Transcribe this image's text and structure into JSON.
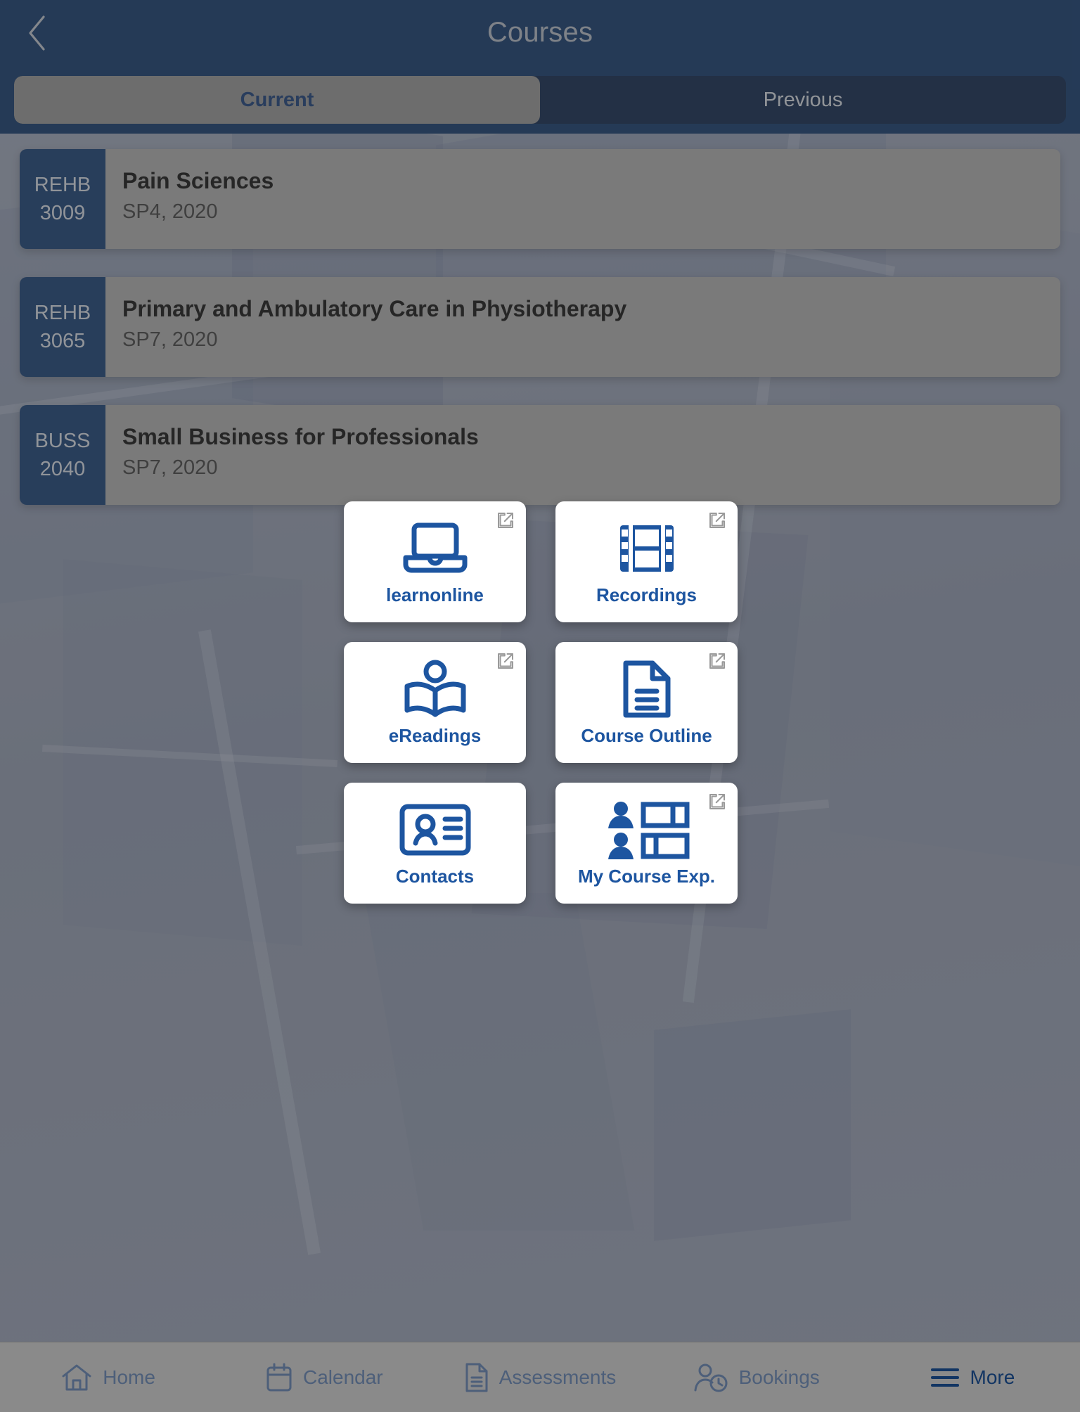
{
  "header": {
    "title": "Courses",
    "back_icon": "chevron-left-icon"
  },
  "tabs": {
    "current_label": "Current",
    "previous_label": "Previous",
    "selected": "Current"
  },
  "courses": [
    {
      "code_prefix": "REHB",
      "code_number": "3009",
      "title": "Pain Sciences",
      "term": "SP4, 2020"
    },
    {
      "code_prefix": "REHB",
      "code_number": "3065",
      "title": "Primary and Ambulatory Care in Physiotherapy",
      "term": "SP7, 2020"
    },
    {
      "code_prefix": "BUSS",
      "code_number": "2040",
      "title": "Small Business for Professionals",
      "term": "SP7, 2020"
    }
  ],
  "action_tiles": [
    {
      "label": "learnonline",
      "icon": "laptop-icon",
      "external": true
    },
    {
      "label": "Recordings",
      "icon": "film-strip-icon",
      "external": true
    },
    {
      "label": "eReadings",
      "icon": "person-reading-icon",
      "external": true
    },
    {
      "label": "Course Outline",
      "icon": "document-icon",
      "external": true
    },
    {
      "label": "Contacts",
      "icon": "contact-card-icon",
      "external": false
    },
    {
      "label": "My Course Exp.",
      "icon": "survey-people-icon",
      "external": true
    }
  ],
  "bottom_nav": [
    {
      "label": "Home",
      "icon": "home-icon",
      "active": false
    },
    {
      "label": "Calendar",
      "icon": "calendar-icon",
      "active": false
    },
    {
      "label": "Assessments",
      "icon": "document-icon",
      "active": false
    },
    {
      "label": "Bookings",
      "icon": "person-clock-icon",
      "active": false
    },
    {
      "label": "More",
      "icon": "hamburger-icon",
      "active": true
    }
  ],
  "colors": {
    "header_navy": "#0e3263",
    "badge_navy": "#143a6b",
    "tile_blue": "#1d55a0",
    "card_gray": "#a0a0a0",
    "nav_bg": "#8a8a8a"
  }
}
